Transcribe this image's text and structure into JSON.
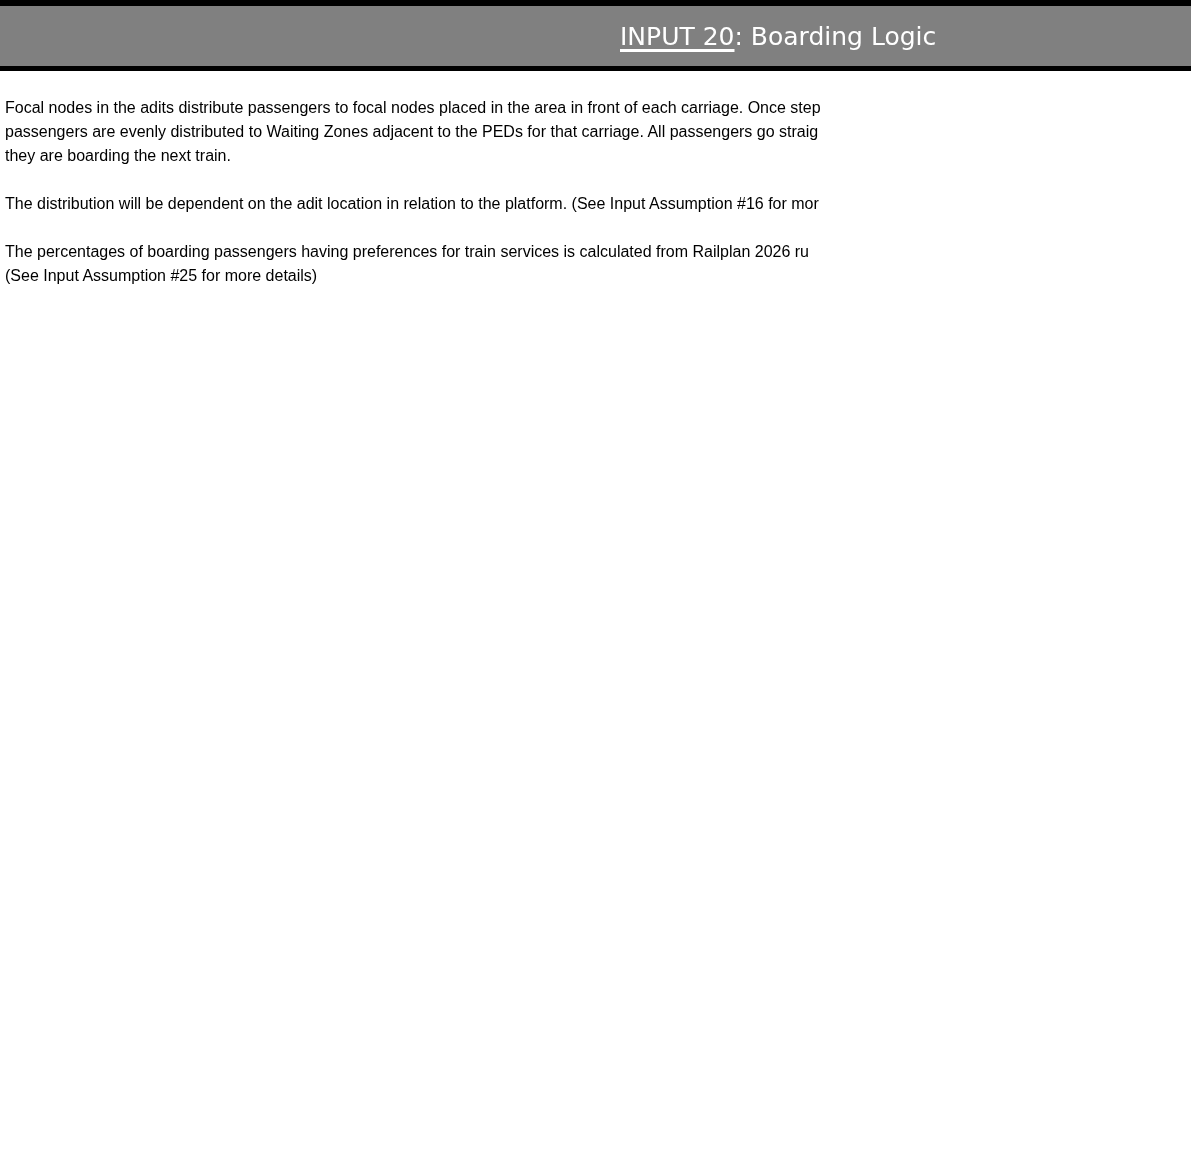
{
  "header": {
    "link": "INPUT 20",
    "rest": ": Boarding Logic"
  },
  "paragraphs": [
    {
      "lines": [
        "Focal nodes in the adits distribute passengers to focal nodes placed in the area in front of each carriage. Once step",
        "passengers are evenly distributed to Waiting Zones adjacent to the PEDs for that carriage. All passengers go straig",
        "they are boarding the next train."
      ]
    },
    {
      "lines": [
        "The distribution will be dependent on the adit location in relation to the platform. (See Input Assumption #16 for mor"
      ]
    },
    {
      "lines": [
        "The percentages of boarding passengers having preferences for train services is calculated from Railplan 2026 ru",
        "(See Input Assumption #25 for more details)"
      ]
    }
  ]
}
